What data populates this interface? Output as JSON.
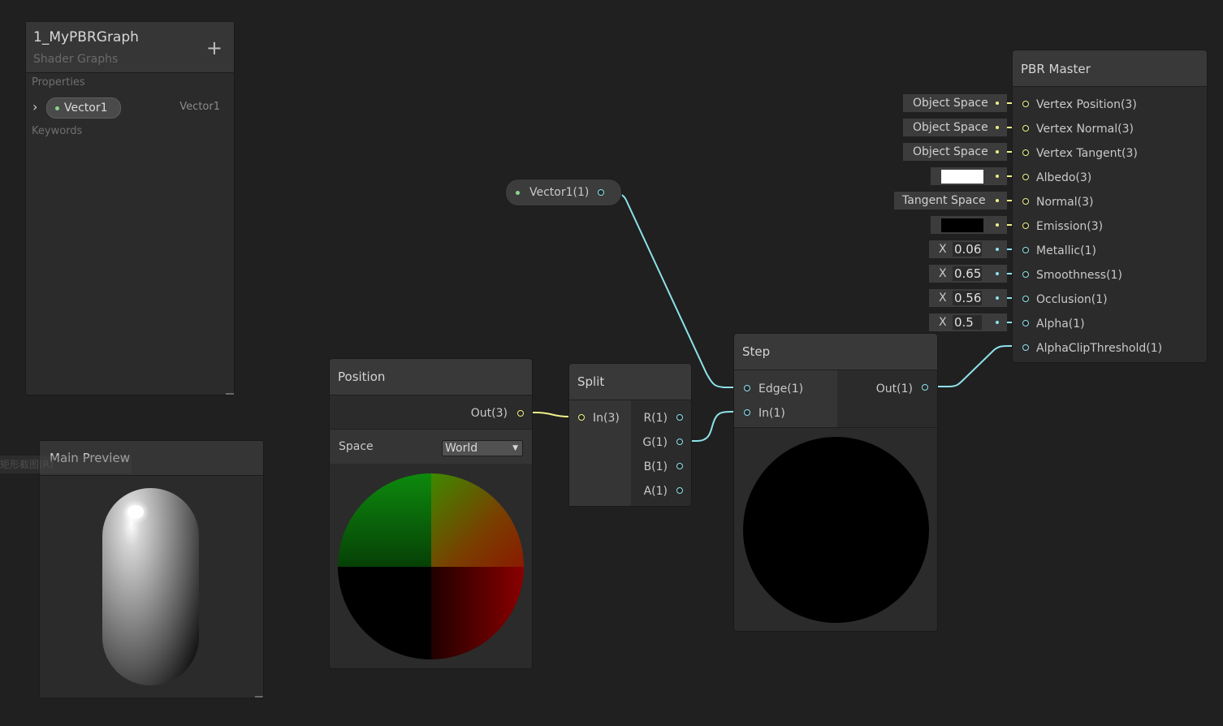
{
  "blackboard": {
    "title": "1_MyPBRGraph",
    "subtitle": "Shader Graphs",
    "add_icon": "+",
    "properties_label": "Properties",
    "keywords_label": "Keywords",
    "property": {
      "name": "Vector1",
      "type": "Vector1"
    }
  },
  "preview": {
    "title": "Main Preview",
    "overlay_hint": "矩形截图(R)"
  },
  "nodes": {
    "position": {
      "title": "Position",
      "output": "Out(3)",
      "space_label": "Space",
      "space_value": "World"
    },
    "split": {
      "title": "Split",
      "input": "In(3)",
      "outputs": [
        "R(1)",
        "G(1)",
        "B(1)",
        "A(1)"
      ]
    },
    "step": {
      "title": "Step",
      "inputs": [
        "Edge(1)",
        "In(1)"
      ],
      "output": "Out(1)"
    },
    "vector1": {
      "label": "Vector1(1)"
    },
    "pbr_master": {
      "title": "PBR Master",
      "ports": [
        "Vertex Position(3)",
        "Vertex Normal(3)",
        "Vertex Tangent(3)",
        "Albedo(3)",
        "Normal(3)",
        "Emission(3)",
        "Metallic(1)",
        "Smoothness(1)",
        "Occlusion(1)",
        "Alpha(1)",
        "AlphaClipThreshold(1)"
      ],
      "inputs": {
        "vertex_position": "Object Space",
        "vertex_normal": "Object Space",
        "vertex_tangent": "Object Space",
        "normal": "Tangent Space",
        "albedo_color": "#ffffff",
        "emission_color": "#000000",
        "metallic": {
          "axis": "X",
          "value": "0.06"
        },
        "smoothness": {
          "axis": "X",
          "value": "0.65"
        },
        "occlusion": {
          "axis": "X",
          "value": "0.56"
        },
        "alpha": {
          "axis": "X",
          "value": "0.5"
        }
      }
    }
  },
  "colors": {
    "vector3_wire": "#f0f08a",
    "vector1_wire": "#8ee2ea",
    "background": "#202020"
  }
}
